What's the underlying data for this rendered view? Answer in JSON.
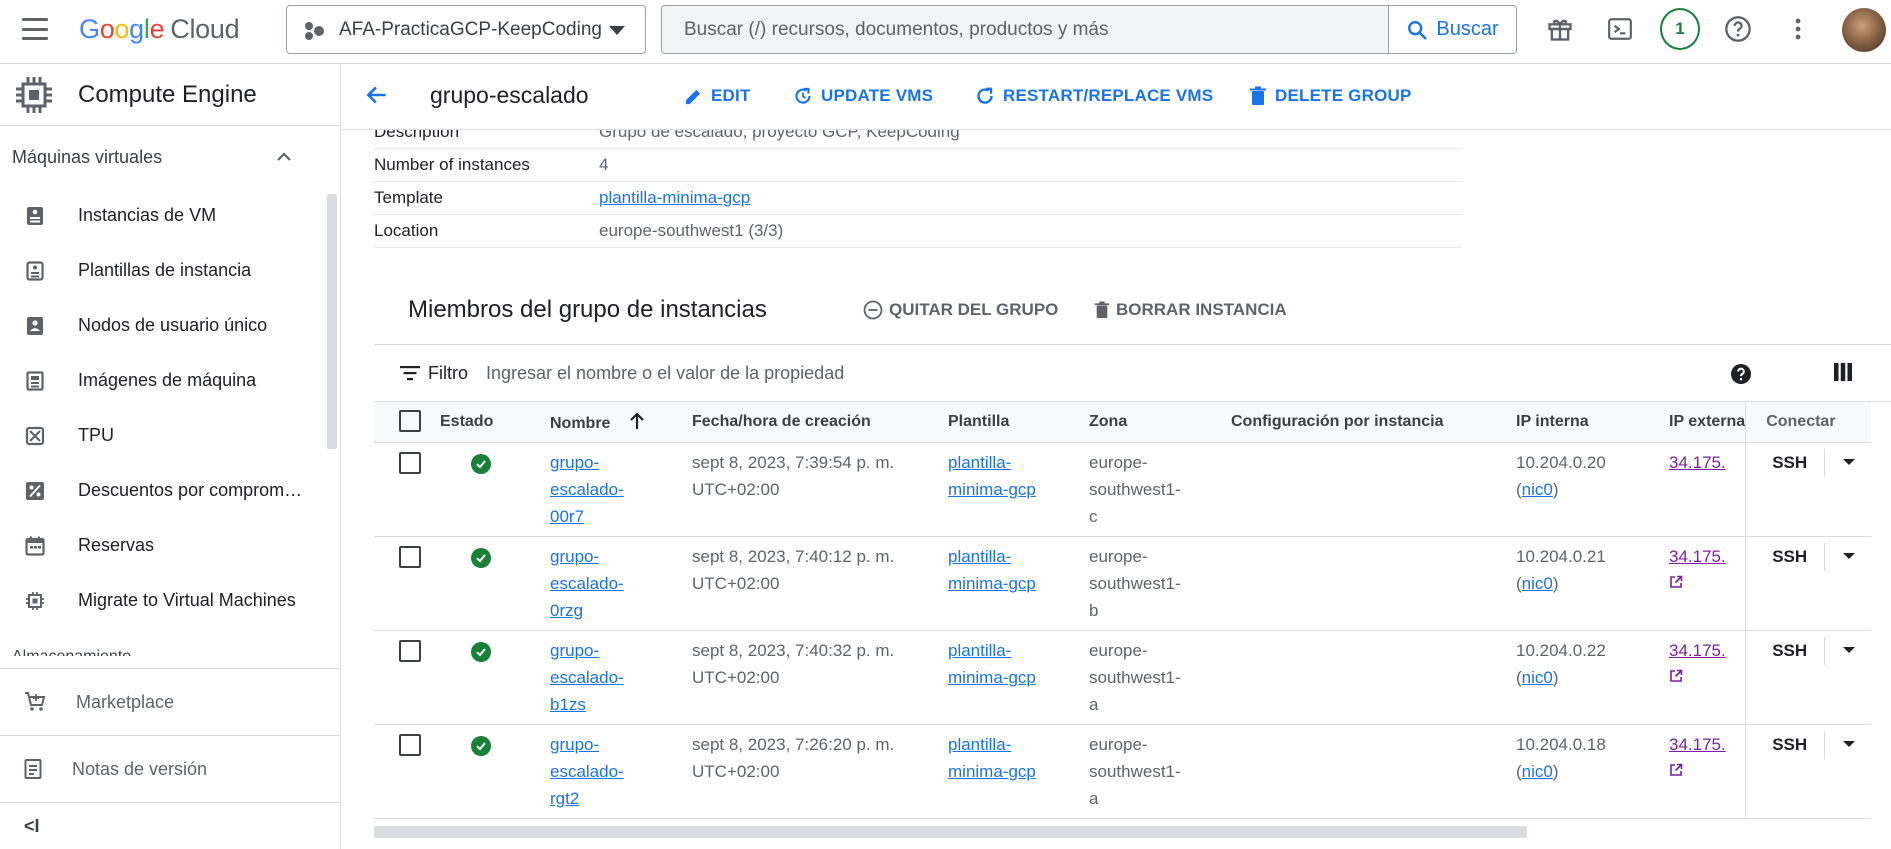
{
  "header": {
    "logo": {
      "g1": "G",
      "g2": "o",
      "g3": "o",
      "g4": "g",
      "g5": "l",
      "g6": "e",
      "cloud": "Cloud"
    },
    "project": "AFA-PracticaGCP-KeepCoding",
    "search_placeholder": "Buscar (/) recursos, documentos, productos y más",
    "search_button": "Buscar",
    "notifications_count": "1"
  },
  "sidebar": {
    "product": "Compute Engine",
    "section": "Máquinas virtuales",
    "items": [
      {
        "label": "Instancias de VM",
        "icon": "vm-instance-icon"
      },
      {
        "label": "Plantillas de instancia",
        "icon": "instance-template-icon"
      },
      {
        "label": "Nodos de usuario único",
        "icon": "sole-tenant-icon"
      },
      {
        "label": "Imágenes de máquina",
        "icon": "machine-image-icon"
      },
      {
        "label": "TPU",
        "icon": "tpu-icon"
      },
      {
        "label": "Descuentos por comprom…",
        "icon": "discount-icon"
      },
      {
        "label": "Reservas",
        "icon": "calendar-icon"
      },
      {
        "label": "Migrate to Virtual Machines",
        "icon": "migrate-icon"
      }
    ],
    "cut_section": "Almacenamiento",
    "marketplace": "Marketplace",
    "release_notes": "Notas de versión",
    "collapse": "<I"
  },
  "page": {
    "title": "grupo-escalado",
    "actions": {
      "edit": "EDIT",
      "update": "UPDATE VMS",
      "restart": "RESTART/REPLACE VMS",
      "delete": "DELETE GROUP"
    },
    "properties": [
      {
        "key": "Description",
        "value": "Grupo de escalado, proyecto GCP, KeepCoding",
        "link": false
      },
      {
        "key": "Number of instances",
        "value": "4",
        "link": false
      },
      {
        "key": "Template",
        "value": "plantilla-minima-gcp",
        "link": true
      },
      {
        "key": "Location",
        "value": "europe-southwest1 (3/3)",
        "link": false
      }
    ]
  },
  "members": {
    "heading": "Miembros del grupo de instancias",
    "remove_label": "QUITAR DEL GRUPO",
    "delete_label": "BORRAR INSTANCIA",
    "filter_label": "Filtro",
    "filter_placeholder": "Ingresar el nombre o el valor de la propiedad",
    "columns": {
      "estado": "Estado",
      "nombre": "Nombre",
      "fecha": "Fecha/hora de creación",
      "plantilla": "Plantilla",
      "zona": "Zona",
      "config": "Configuración por instancia",
      "ip_interna": "IP interna",
      "ip_externa": "IP externa",
      "conectar": "Conectar"
    },
    "rows": [
      {
        "name": [
          "grupo-",
          "escalado-",
          "00r7"
        ],
        "created": [
          "sept 8, 2023, 7:39:54 p. m.",
          "UTC+02:00"
        ],
        "template": [
          "plantilla-",
          "minima-gcp"
        ],
        "zone": [
          "europe-",
          "southwest1-",
          "c"
        ],
        "ip_internal": "10.204.0.20",
        "nic": "nic0",
        "ip_external": "34.175.",
        "ext_link_icon": false,
        "connect": "SSH"
      },
      {
        "name": [
          "grupo-",
          "escalado-",
          "0rzg"
        ],
        "created": [
          "sept 8, 2023, 7:40:12 p. m.",
          "UTC+02:00"
        ],
        "template": [
          "plantilla-",
          "minima-gcp"
        ],
        "zone": [
          "europe-",
          "southwest1-",
          "b"
        ],
        "ip_internal": "10.204.0.21",
        "nic": "nic0",
        "ip_external": "34.175.",
        "ext_link_icon": true,
        "connect": "SSH"
      },
      {
        "name": [
          "grupo-",
          "escalado-",
          "b1zs"
        ],
        "created": [
          "sept 8, 2023, 7:40:32 p. m.",
          "UTC+02:00"
        ],
        "template": [
          "plantilla-",
          "minima-gcp"
        ],
        "zone": [
          "europe-",
          "southwest1-",
          "a"
        ],
        "ip_internal": "10.204.0.22",
        "nic": "nic0",
        "ip_external": "34.175.",
        "ext_link_icon": true,
        "connect": "SSH"
      },
      {
        "name": [
          "grupo-",
          "escalado-",
          "rgt2"
        ],
        "created": [
          "sept 8, 2023, 7:26:20 p. m.",
          "UTC+02:00"
        ],
        "template": [
          "plantilla-",
          "minima-gcp"
        ],
        "zone": [
          "europe-",
          "southwest1-",
          "a"
        ],
        "ip_internal": "10.204.0.18",
        "nic": "nic0",
        "ip_external": "34.175.",
        "ext_link_icon": true,
        "connect": "SSH"
      }
    ]
  },
  "colors": {
    "accent": "#1a73e8",
    "status_ok": "#188038",
    "visited_link": "#7b1fa2"
  }
}
